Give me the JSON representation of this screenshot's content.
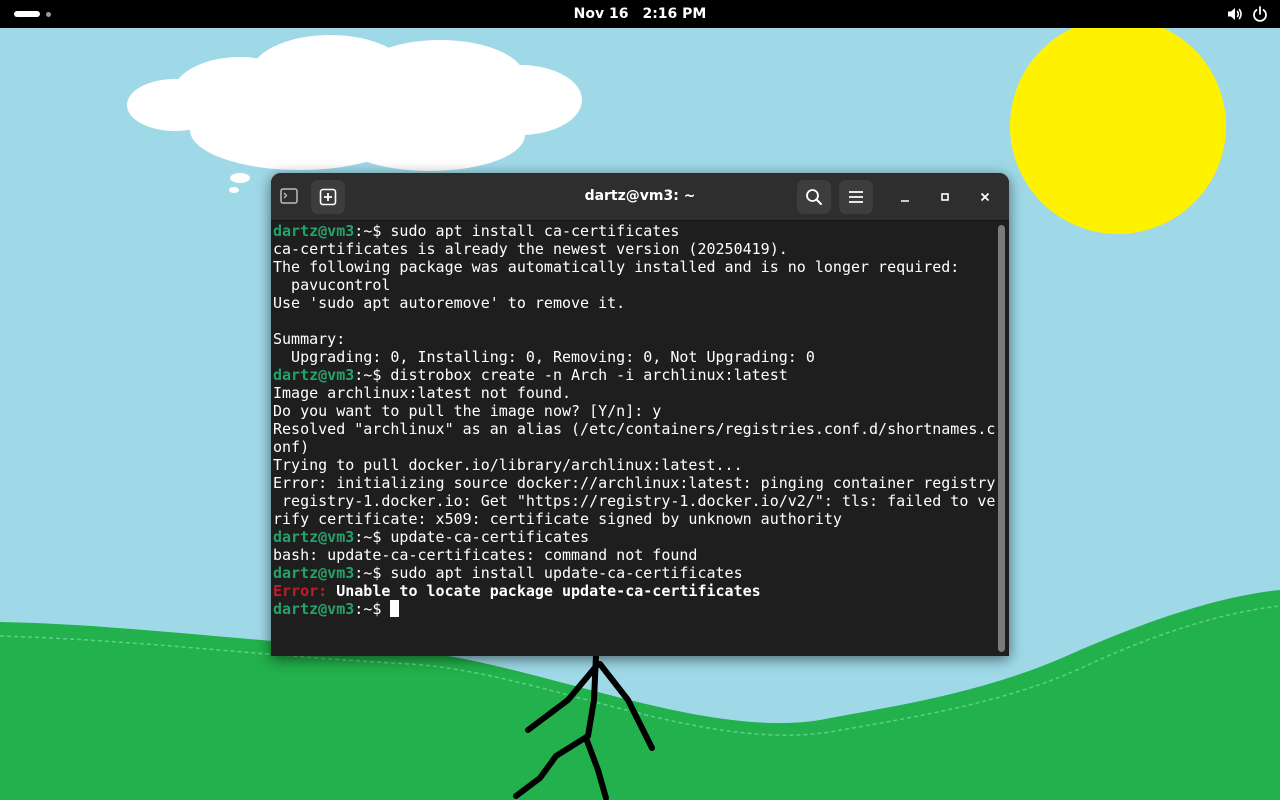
{
  "topbar": {
    "date": "Nov 16",
    "time": "2:16 PM",
    "icons": [
      "activities-indicator",
      "volume-icon",
      "power-icon"
    ]
  },
  "window": {
    "title": "dartz@vm3: ~",
    "buttons": [
      "terminal-icon",
      "new-tab-button",
      "search-button",
      "menu-button",
      "minimize-button",
      "maximize-button",
      "close-button"
    ]
  },
  "terminal": {
    "prompt_user": "dartz@vm3",
    "prompt_tail": ":~$ ",
    "lines": [
      {
        "type": "prompt",
        "cmd": "sudo apt install ca-certificates"
      },
      {
        "type": "out",
        "text": "ca-certificates is already the newest version (20250419)."
      },
      {
        "type": "out",
        "text": "The following package was automatically installed and is no longer required:"
      },
      {
        "type": "out",
        "text": "  pavucontrol"
      },
      {
        "type": "out",
        "text": "Use 'sudo apt autoremove' to remove it."
      },
      {
        "type": "out",
        "text": ""
      },
      {
        "type": "out",
        "text": "Summary:"
      },
      {
        "type": "out",
        "text": "  Upgrading: 0, Installing: 0, Removing: 0, Not Upgrading: 0"
      },
      {
        "type": "prompt",
        "cmd": "distrobox create -n Arch -i archlinux:latest"
      },
      {
        "type": "out",
        "text": "Image archlinux:latest not found."
      },
      {
        "type": "out",
        "text": "Do you want to pull the image now? [Y/n]: y"
      },
      {
        "type": "out",
        "text": "Resolved \"archlinux\" as an alias (/etc/containers/registries.conf.d/shortnames.c"
      },
      {
        "type": "out",
        "text": "onf)"
      },
      {
        "type": "out",
        "text": "Trying to pull docker.io/library/archlinux:latest..."
      },
      {
        "type": "out",
        "text": "Error: initializing source docker://archlinux:latest: pinging container registry"
      },
      {
        "type": "out",
        "text": " registry-1.docker.io: Get \"https://registry-1.docker.io/v2/\": tls: failed to ve"
      },
      {
        "type": "out",
        "text": "rify certificate: x509: certificate signed by unknown authority"
      },
      {
        "type": "prompt",
        "cmd": "update-ca-certificates"
      },
      {
        "type": "out",
        "text": "bash: update-ca-certificates: command not found"
      },
      {
        "type": "prompt",
        "cmd": "sudo apt install update-ca-certificates"
      },
      {
        "type": "error",
        "label": "Error:",
        "text": " Unable to locate package update-ca-certificates"
      },
      {
        "type": "prompt-cursor",
        "cmd": ""
      }
    ]
  },
  "colors": {
    "sky": "#9fd9e8",
    "grass": "#22b14c",
    "sun": "#fff200",
    "prompt_green": "#26a269",
    "error_red": "#c01c28",
    "terminal_bg": "#1e1e1e",
    "headerbar_bg": "#2e2e2e"
  }
}
